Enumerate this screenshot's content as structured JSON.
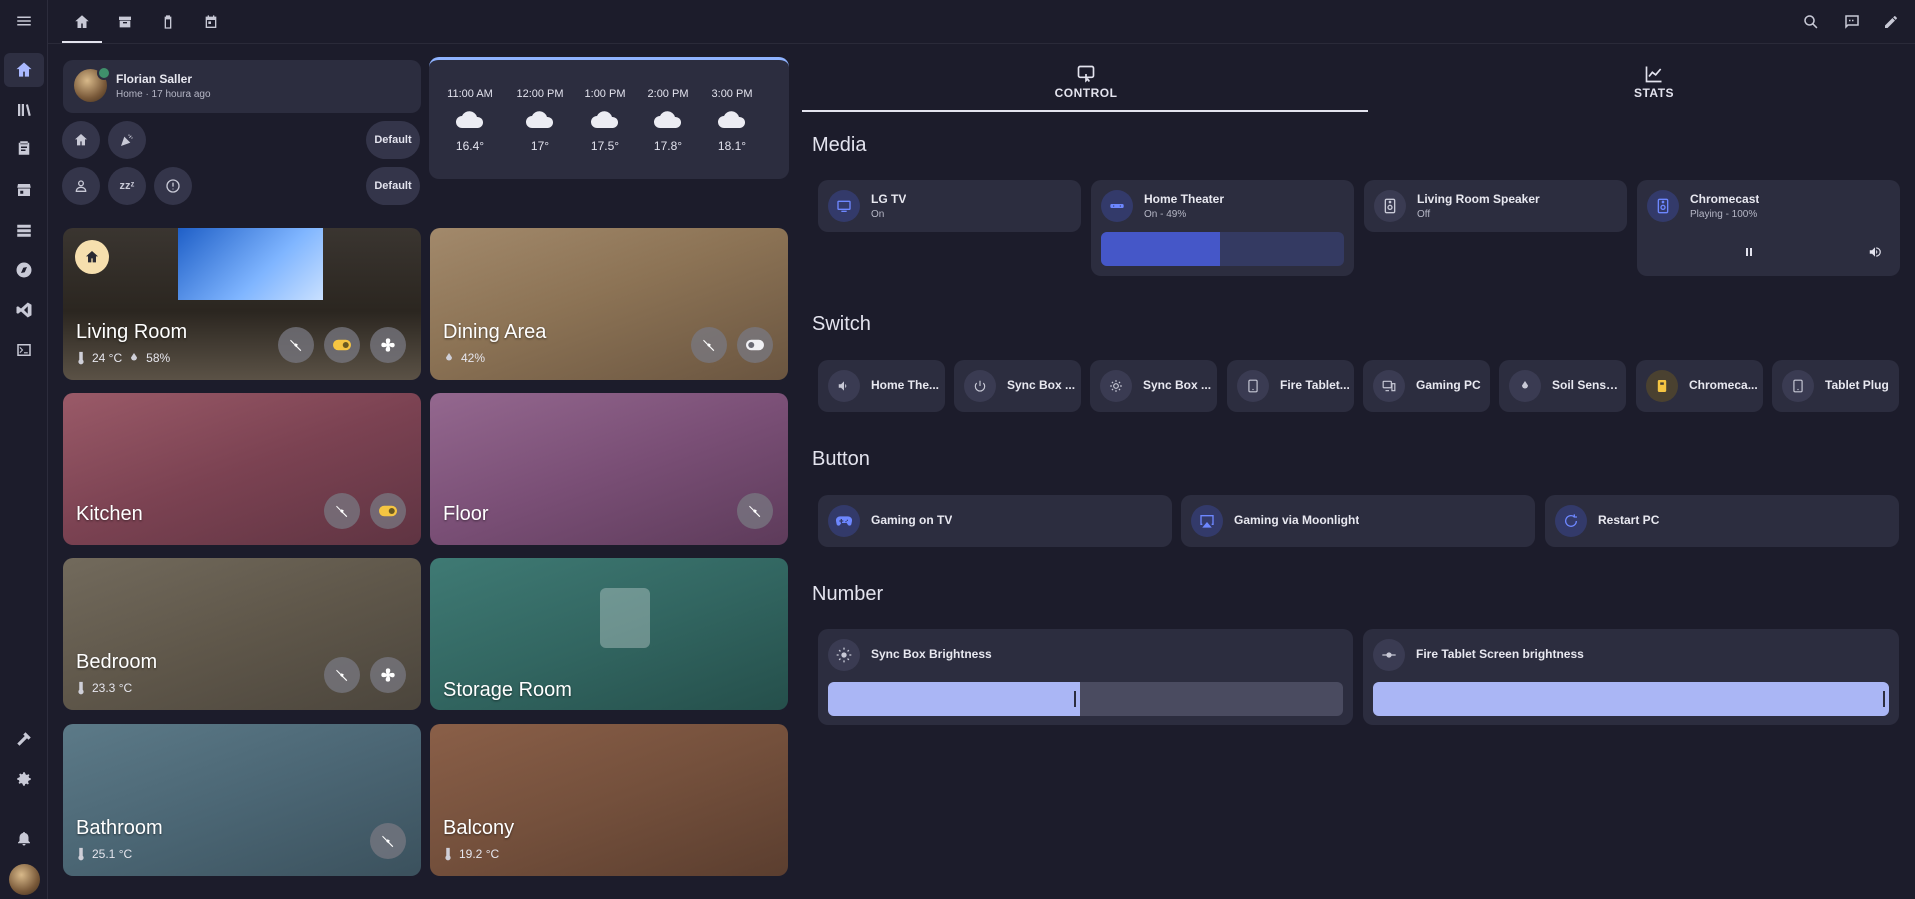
{
  "user": {
    "name": "Florian Saller",
    "status": "Home · 17 houra ago"
  },
  "modes": {
    "default_1": "Default",
    "default_2": "Default"
  },
  "weather": [
    {
      "time": "11:00 AM",
      "temp": "16.4°"
    },
    {
      "time": "12:00 PM",
      "temp": "17°"
    },
    {
      "time": "1:00 PM",
      "temp": "17.5°"
    },
    {
      "time": "2:00 PM",
      "temp": "17.8°"
    },
    {
      "time": "3:00 PM",
      "temp": "18.1°"
    }
  ],
  "areas": {
    "living": {
      "name": "Living Room",
      "temp": "24 °C",
      "humidity": "58%"
    },
    "dining": {
      "name": "Dining Area",
      "humidity": "42%"
    },
    "kitchen": {
      "name": "Kitchen"
    },
    "floor": {
      "name": "Floor"
    },
    "bedroom": {
      "name": "Bedroom",
      "temp": "23.3 °C"
    },
    "storage": {
      "name": "Storage Room"
    },
    "bathroom": {
      "name": "Bathroom",
      "temp": "25.1 °C"
    },
    "balcony": {
      "name": "Balcony",
      "temp": "19.2 °C"
    }
  },
  "tabs": {
    "control": "CONTROL",
    "stats": "STATS"
  },
  "sections": {
    "media": "Media",
    "switch": "Switch",
    "button": "Button",
    "number": "Number"
  },
  "media": [
    {
      "name": "LG TV",
      "state": "On"
    },
    {
      "name": "Home Theater",
      "state": "On - 49%",
      "level_percent": 49
    },
    {
      "name": "Living Room Speaker",
      "state": "Off"
    },
    {
      "name": "Chromecast",
      "state": "Playing - 100%"
    }
  ],
  "switches": [
    "Home The...",
    "Sync Box ...",
    "Sync Box ...",
    "Fire Tablet...",
    "Gaming PC",
    "Soil Senso...",
    "Chromeca...",
    "Tablet Plug"
  ],
  "buttons": [
    "Gaming on TV",
    "Gaming via Moonlight",
    "Restart PC"
  ],
  "numbers": [
    {
      "name": "Sync Box Brightness",
      "value_fraction": 0.49
    },
    {
      "name": "Fire Tablet Screen brightness",
      "value_fraction": 1.0
    }
  ],
  "colors": {
    "accent": "#4557c8",
    "slider": "#aab6f5",
    "on_yellow": "#f5c542",
    "card": "#2c2d3f",
    "bg": "#1c1c2b"
  }
}
